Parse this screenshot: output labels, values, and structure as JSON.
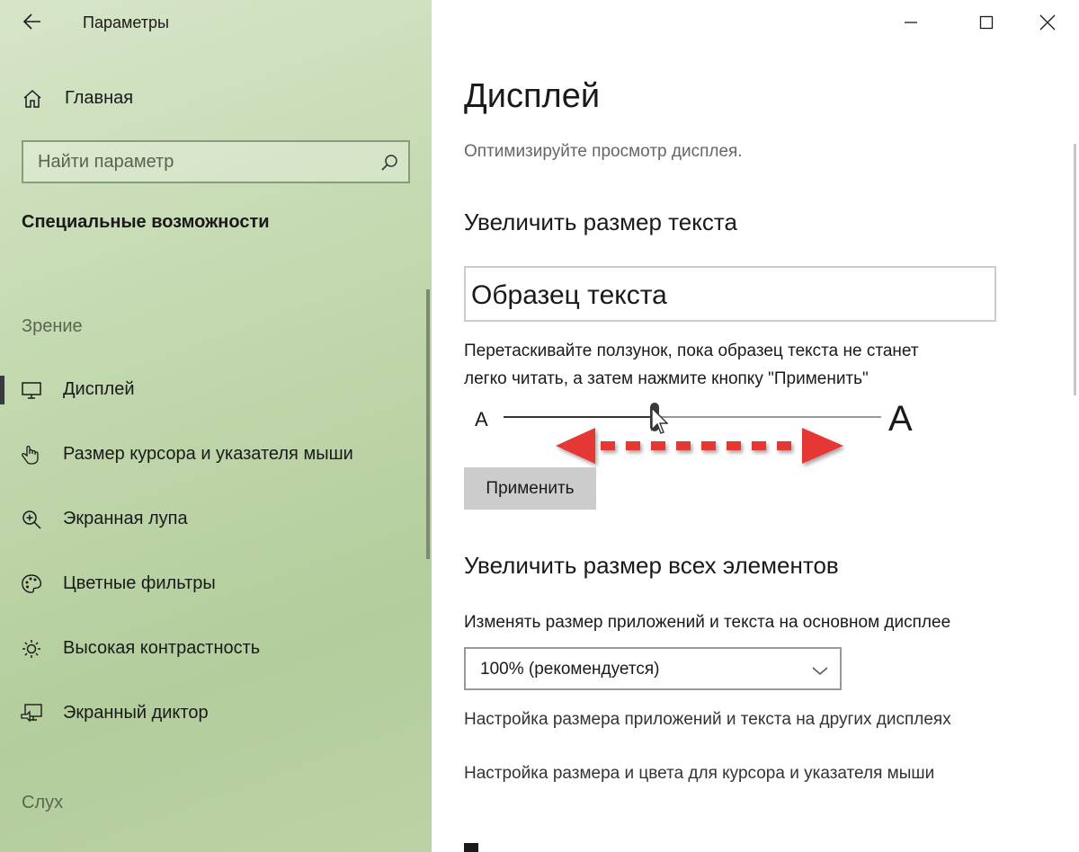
{
  "window": {
    "app_title": "Параметры",
    "controls": [
      "minimize-icon",
      "maximize-icon",
      "close-icon"
    ]
  },
  "sidebar": {
    "home_label": "Главная",
    "search_placeholder": "Найти параметр",
    "section_title": "Специальные возможности",
    "group_vision": "Зрение",
    "group_hearing": "Слух",
    "items": [
      {
        "label": "Дисплей",
        "icon": "monitor-icon",
        "active": true
      },
      {
        "label": "Размер курсора и указателя мыши",
        "icon": "hand-pointer-icon",
        "active": false
      },
      {
        "label": "Экранная лупа",
        "icon": "zoom-in-icon",
        "active": false
      },
      {
        "label": "Цветные фильтры",
        "icon": "palette-icon",
        "active": false
      },
      {
        "label": "Высокая контрастность",
        "icon": "sun-icon",
        "active": false
      },
      {
        "label": "Экранный диктор",
        "icon": "narrator-icon",
        "active": false
      }
    ]
  },
  "main": {
    "title": "Дисплей",
    "subtitle": "Оптимизируйте просмотр дисплея.",
    "text_size": {
      "heading": "Увеличить размер текста",
      "preview": "Образец текста",
      "description_line1": "Перетаскивайте ползунок, пока образец текста не станет",
      "description_line2": "легко читать, а затем нажмите кнопку \"Применить\"",
      "slider_min_label": "A",
      "slider_max_label": "A",
      "slider_value": 0.4,
      "apply_button": "Применить"
    },
    "all_elements": {
      "heading": "Увеличить размер всех элементов",
      "field_label": "Изменять размер приложений и текста на основном дисплее",
      "dropdown_value": "100% (рекомендуется)",
      "link_other_displays": "Настройка размера приложений и текста на других дисплеях",
      "link_cursor": "Настройка размера и цвета для курсора и указателя мыши"
    }
  },
  "colors": {
    "sidebar_bg": "#c2d8ae",
    "arrow_red": "#e53935",
    "text": "#1a1a1a"
  }
}
